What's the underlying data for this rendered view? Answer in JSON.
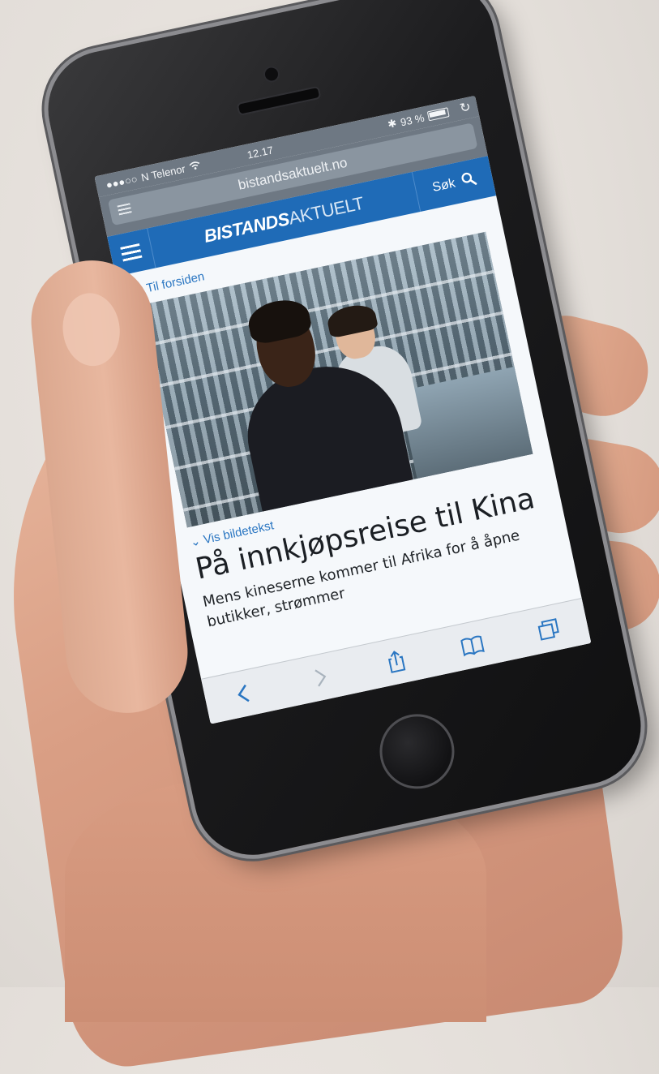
{
  "status_bar": {
    "carrier": "N Telenor",
    "time": "12.17",
    "battery": "93 %"
  },
  "browser": {
    "url": "bistandsaktuelt.no"
  },
  "site_header": {
    "logo_bold": "BISTANDS",
    "logo_light": "AKTUELT",
    "search_label": "Søk"
  },
  "article": {
    "back_link": "Til forsiden",
    "caption_toggle": "Vis bildetekst",
    "headline": "På innkjøpsreise til Kina",
    "lead": "Mens kineserne kommer til Afrika for å åpne butikker, strømmer"
  },
  "icons": {
    "wifi": "wifi-icon",
    "bluetooth": "bluetooth-icon",
    "reload": "reload-icon",
    "reader": "reader-icon",
    "menu": "hamburger-icon",
    "search": "search-icon",
    "back": "chevron-left-icon",
    "forward": "chevron-right-icon",
    "share": "share-icon",
    "bookmarks": "book-icon",
    "tabs": "tabs-icon"
  },
  "colors": {
    "site_blue": "#1f6bb7",
    "link_blue": "#2a76c2",
    "browser_chrome": "#6e7883"
  }
}
